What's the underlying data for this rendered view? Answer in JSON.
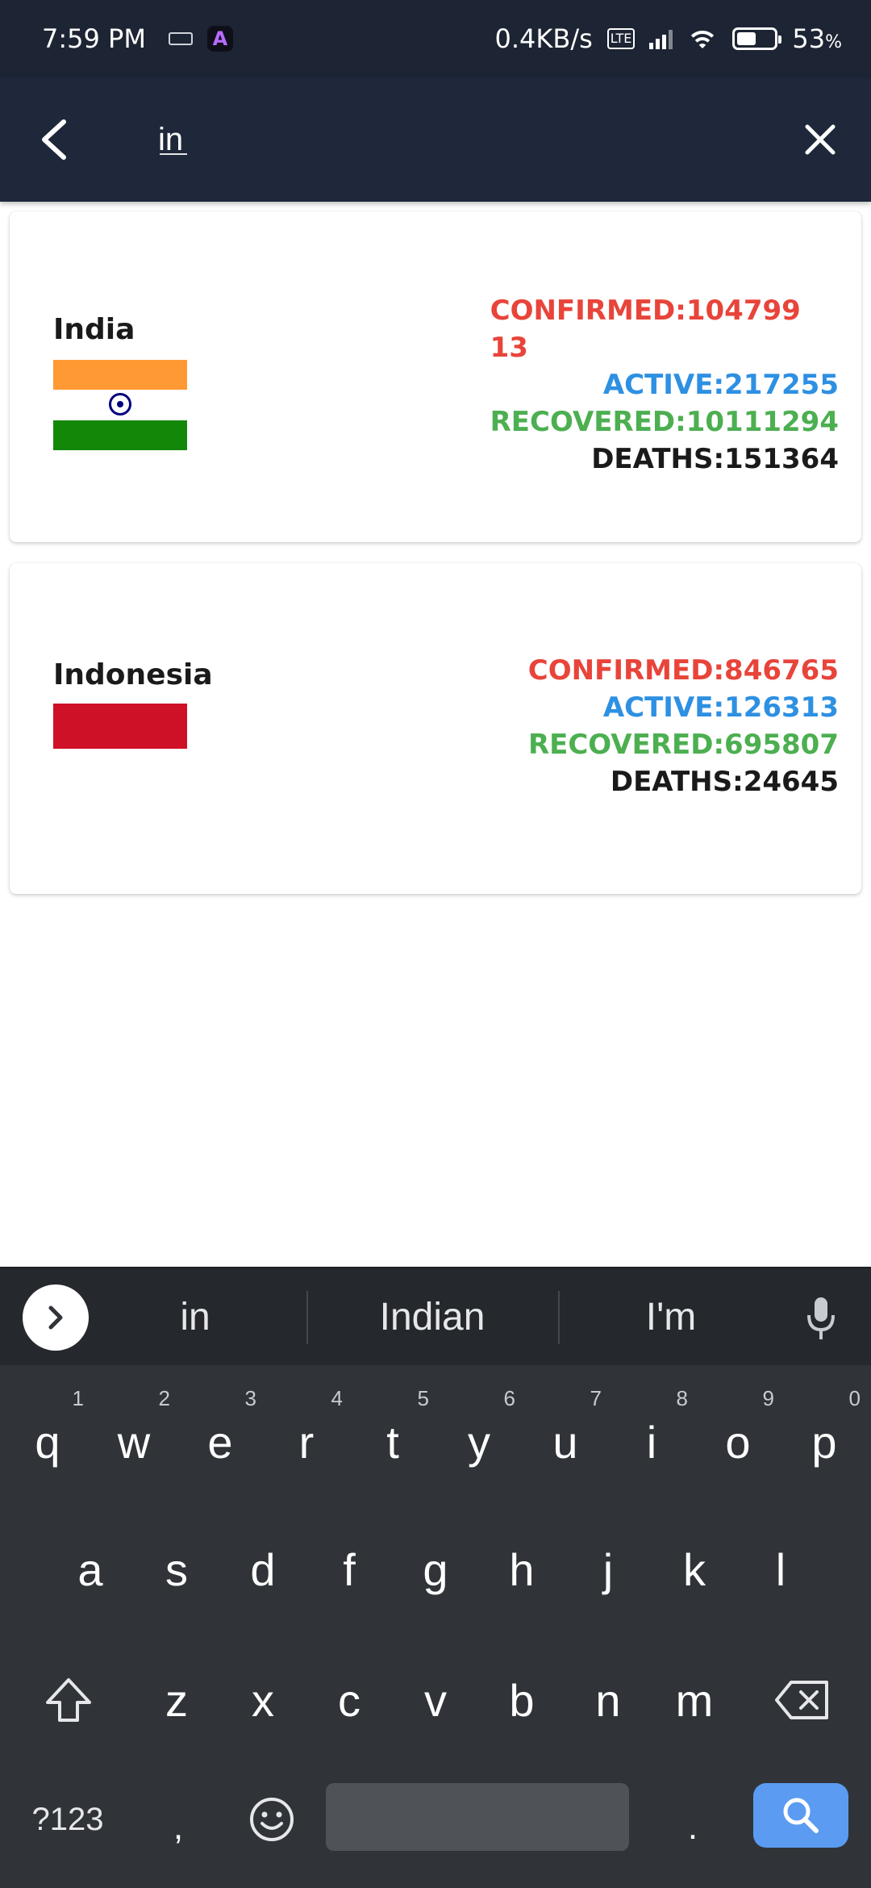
{
  "status_bar": {
    "time": "7:59 PM",
    "app_icon_letter": "A",
    "network_speed": "0.4KB/s",
    "volte_label": "Vo LTE",
    "battery_percent": "53",
    "battery_level": 0.53,
    "percent_sign": "%"
  },
  "search": {
    "query": "in",
    "back_icon": "arrow-back-icon",
    "clear_icon": "close-icon"
  },
  "results": [
    {
      "country": "India",
      "flag": "india-flag",
      "confirmed": "CONFIRMED:10479913",
      "active": "ACTIVE:217255",
      "recovered": "RECOVERED:10111294",
      "deaths": "DEATHS:151364"
    },
    {
      "country": "Indonesia",
      "flag": "indonesia-flag",
      "confirmed": "CONFIRMED:846765",
      "active": "ACTIVE:126313",
      "recovered": "RECOVERED:695807",
      "deaths": "DEATHS:24645"
    }
  ],
  "colors": {
    "confirmed": "#e8443a",
    "active": "#2e90e2",
    "recovered": "#4caf50",
    "deaths": "#1a1a1a",
    "app_bar": "#1e283a",
    "keyboard_accent": "#5b9cf2"
  },
  "keyboard": {
    "suggestions": [
      "in",
      "Indian",
      "I'm"
    ],
    "row1": [
      "q",
      "w",
      "e",
      "r",
      "t",
      "y",
      "u",
      "i",
      "o",
      "p"
    ],
    "row1_hints": [
      "1",
      "2",
      "3",
      "4",
      "5",
      "6",
      "7",
      "8",
      "9",
      "0"
    ],
    "row2": [
      "a",
      "s",
      "d",
      "f",
      "g",
      "h",
      "j",
      "k",
      "l"
    ],
    "row3": [
      "z",
      "x",
      "c",
      "v",
      "b",
      "n",
      "m"
    ],
    "symbols_label": "?123",
    "comma_label": ",",
    "period_label": ".",
    "shift_icon": "shift-icon",
    "backspace_icon": "backspace-icon",
    "emoji_icon": "emoji-icon",
    "search_icon": "search-icon",
    "mic_icon": "mic-icon",
    "expand_icon": "chevron-right-icon"
  }
}
